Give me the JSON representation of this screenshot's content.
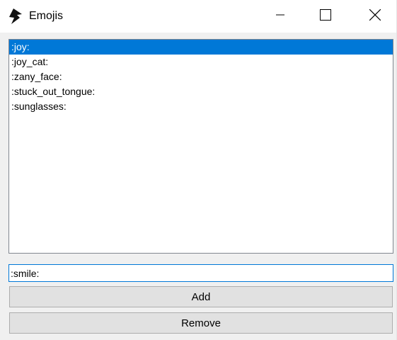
{
  "window": {
    "title": "Emojis",
    "app_icon": "lightning-bolt-icon",
    "controls": {
      "minimize_icon": "minimize-icon",
      "maximize_icon": "maximize-icon",
      "close_icon": "close-icon"
    }
  },
  "emoji_list": {
    "selected_index": 0,
    "items": [
      ":joy:",
      ":joy_cat:",
      ":zany_face:",
      ":stuck_out_tongue:",
      ":sunglasses:"
    ]
  },
  "entry": {
    "value": ":smile:"
  },
  "buttons": {
    "add_label": "Add",
    "remove_label": "Remove"
  },
  "colors": {
    "selection": "#0078d7",
    "button_face": "#e1e1e1",
    "window_bg": "#f0f0f0"
  }
}
